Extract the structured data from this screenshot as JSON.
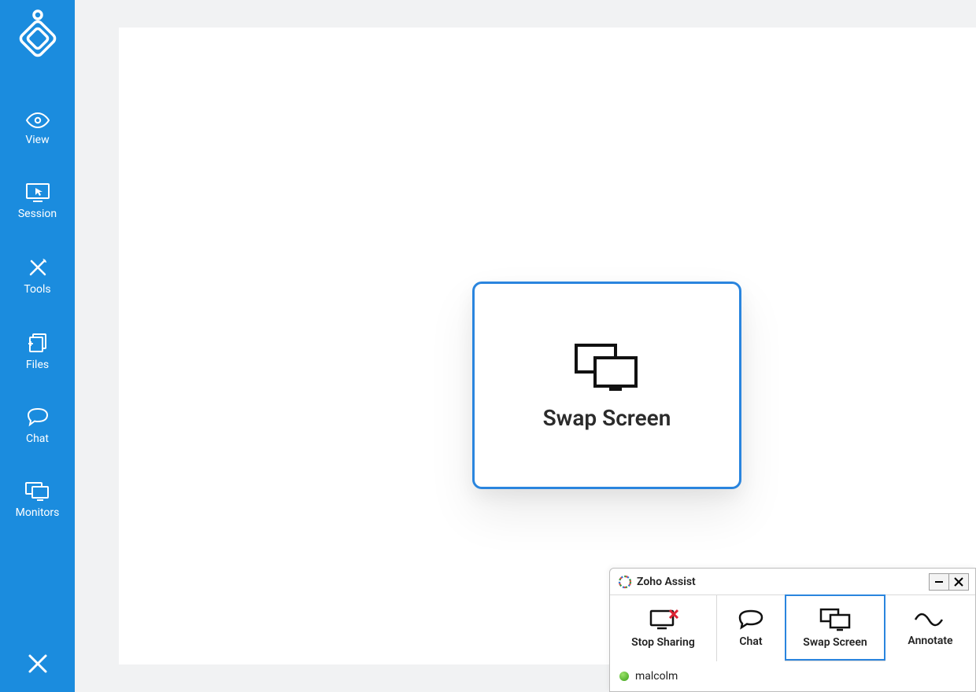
{
  "sidebar": {
    "items": [
      {
        "label": "View"
      },
      {
        "label": "Session"
      },
      {
        "label": "Tools"
      },
      {
        "label": "Files"
      },
      {
        "label": "Chat"
      },
      {
        "label": "Monitors"
      }
    ]
  },
  "callout": {
    "label": "Swap Screen"
  },
  "panel": {
    "title": "Zoho Assist",
    "toolbar": {
      "stop_sharing": "Stop Sharing",
      "chat": "Chat",
      "swap_screen": "Swap Screen",
      "annotate": "Annotate"
    },
    "status": {
      "username": "malcolm"
    }
  }
}
